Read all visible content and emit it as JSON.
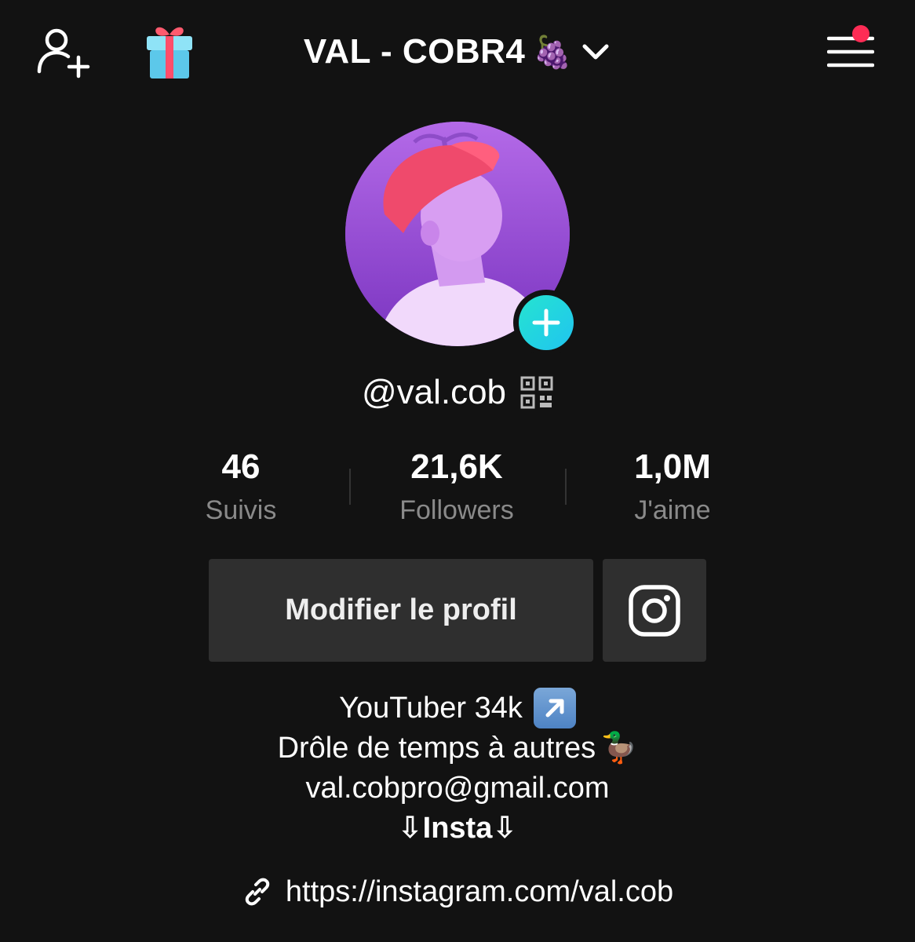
{
  "header": {
    "title": "VAL - COBR4",
    "title_emoji": "🍇",
    "notification_dot_color": "#fe2c55"
  },
  "profile": {
    "username": "@val.cob",
    "add_button_colors": [
      "#25e4d0",
      "#20c4f0"
    ]
  },
  "stats": [
    {
      "value": "46",
      "label": "Suivis"
    },
    {
      "value": "21,6K",
      "label": "Followers"
    },
    {
      "value": "1,0M",
      "label": "J'aime"
    }
  ],
  "actions": {
    "edit_profile_label": "Modifier le profil"
  },
  "bio": {
    "line1": "YouTuber 34k",
    "line2": "Drôle de temps à autres",
    "line2_emoji": "🦆",
    "line3": "val.cobpro@gmail.com",
    "line4_arrow_left": "⇩",
    "line4_text": "Insta",
    "line4_arrow_right": "⇩"
  },
  "link": {
    "url": "https://instagram.com/val.cob"
  },
  "icons": {
    "add_user": "add-user-icon",
    "gift": "gift-icon",
    "chevron": "chevron-down-icon",
    "menu": "hamburger-menu-icon",
    "qr": "qr-code-icon",
    "instagram": "instagram-icon",
    "link": "link-icon",
    "arrow_badge": "up-right-arrow-icon"
  }
}
